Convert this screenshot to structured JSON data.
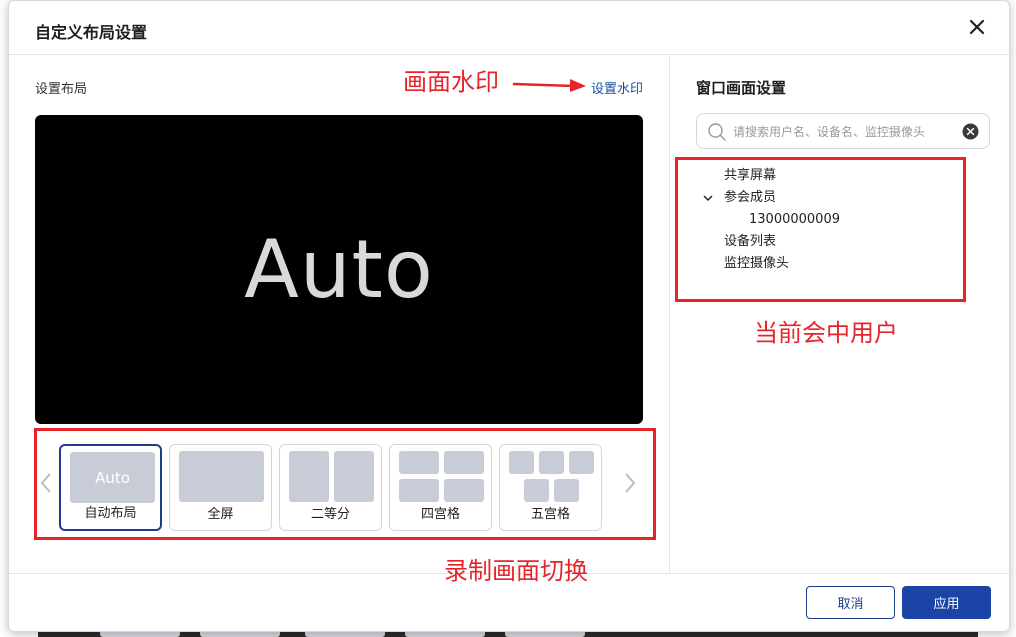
{
  "dialog": {
    "title": "自定义布局设置"
  },
  "left": {
    "section_label": "设置布局",
    "watermark_link": "设置水印",
    "preview_text": "Auto",
    "layouts": [
      {
        "label": "自动布局",
        "thumb_text": "Auto",
        "selected": true
      },
      {
        "label": "全屏",
        "selected": false
      },
      {
        "label": "二等分",
        "selected": false
      },
      {
        "label": "四宫格",
        "selected": false
      },
      {
        "label": "五宫格",
        "selected": false
      }
    ]
  },
  "right": {
    "title": "窗口画面设置",
    "search_placeholder": "请搜索用户名、设备名、监控摄像头",
    "tree": {
      "shared_screen": "共享屏幕",
      "participants": "参会成员",
      "participant_1": "13000000009",
      "device_list": "设备列表",
      "cameras": "监控摄像头"
    }
  },
  "annotations": {
    "watermark": "画面水印",
    "current_users": "当前会中用户",
    "record_switch": "录制画面切换"
  },
  "footer": {
    "cancel_label": "取消",
    "apply_label": "应用"
  },
  "colors": {
    "primary": "#1c44a6",
    "annotation": "#e8242b",
    "thumb": "#c8ccd6"
  }
}
